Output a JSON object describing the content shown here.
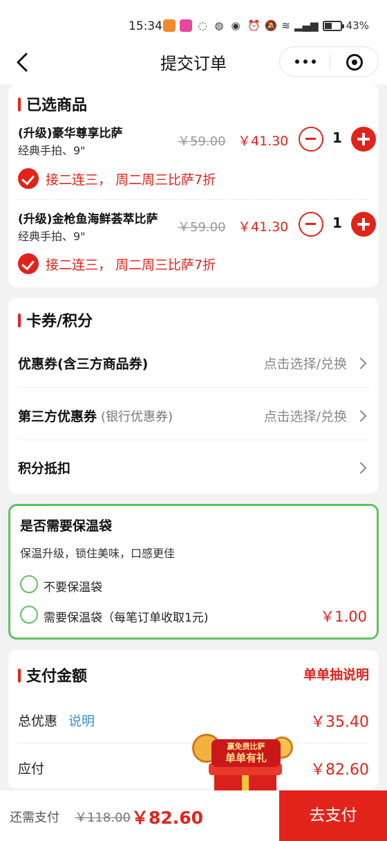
{
  "status_bar": {
    "time": "15:34",
    "battery": "43%",
    "icons": [
      "notification-app-icon",
      "notification-app-icon",
      "chat-icon",
      "shield-icon",
      "location-icon",
      "alarm-icon",
      "mute-icon",
      "wifi-icon",
      "signal-icon",
      "battery-icon"
    ]
  },
  "nav": {
    "title": "提交订单"
  },
  "selected_items": {
    "title": "已选商品",
    "items": [
      {
        "name": "(升级)豪华尊享比萨",
        "spec": "经典手拍、9\"",
        "old_price": "￥59.00",
        "price": "￥41.30",
        "qty": "1",
        "promo": "接二连三， 周二周三比萨7折"
      },
      {
        "name": "(升级)金枪鱼海鲜荟萃比萨",
        "spec": "经典手拍、9\"",
        "old_price": "￥59.00",
        "price": "￥41.30",
        "qty": "1",
        "promo": "接二连三， 周二周三比萨7折"
      }
    ]
  },
  "coupons": {
    "title": "卡券/积分",
    "rows": [
      {
        "label": "优惠券(含三方商品券)",
        "sub": "",
        "action": "点击选择/兑换"
      },
      {
        "label": "第三方优惠券",
        "sub": "(银行优惠券)",
        "action": "点击选择/兑换"
      },
      {
        "label": "积分抵扣",
        "sub": "",
        "action": ""
      }
    ]
  },
  "thermal_bag": {
    "title": "是否需要保温袋",
    "desc": "保温升级，锁住美味，口感更佳",
    "options": [
      {
        "label": "不要保温袋",
        "price": ""
      },
      {
        "label": "需要保温袋（每笔订单收取1元)",
        "price": "￥1.00"
      }
    ]
  },
  "payment": {
    "title": "支付金额",
    "link": "单单抽说明",
    "discount_label": "总优惠",
    "discount_explain": "说明",
    "discount_value": "￥35.40",
    "due_label": "应付",
    "due_value": "￥82.60"
  },
  "gift_badge": {
    "line1": "赢免费比萨",
    "line2": "单单有礼"
  },
  "bottom_bar": {
    "label": "还需支付",
    "old_total": "￥118.00",
    "total": "￥82.60",
    "pay_button": "去支付"
  },
  "colors": {
    "accent_red": "#e2231a",
    "green_border": "#5ec25e",
    "link_blue": "#3a8fd6"
  }
}
